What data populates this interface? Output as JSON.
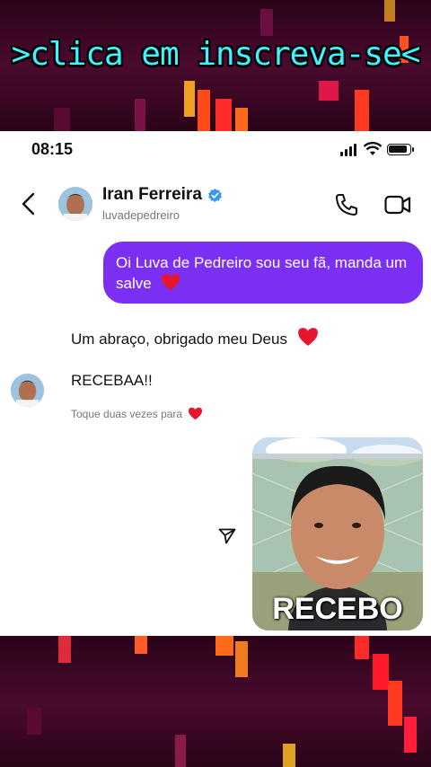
{
  "overlay": {
    "promo_text": ">clica em inscreva-se<"
  },
  "status_bar": {
    "time": "08:15",
    "icons": [
      "signal-icon",
      "wifi-icon",
      "battery-icon"
    ]
  },
  "header": {
    "contact_name": "Iran Ferreira",
    "handle": "luvadepedreiro",
    "icons": [
      "back-chevron-icon",
      "verified-badge-icon",
      "phone-call-icon",
      "video-call-icon"
    ]
  },
  "messages": {
    "outgoing_1": "Oi Luva de Pedreiro sou seu fã, manda um salve",
    "incoming_1": "Um abraço, obrigado meu Deus",
    "incoming_2": "RECEBAA!!",
    "double_tap_hint": "Toque duas vezes para",
    "photo_caption": "RECEBO"
  },
  "colors": {
    "outgoing_bubble": "#7b2ff2",
    "heart": "#e8152e",
    "verified": "#3897f0",
    "promo_text": "#3df5ff"
  }
}
